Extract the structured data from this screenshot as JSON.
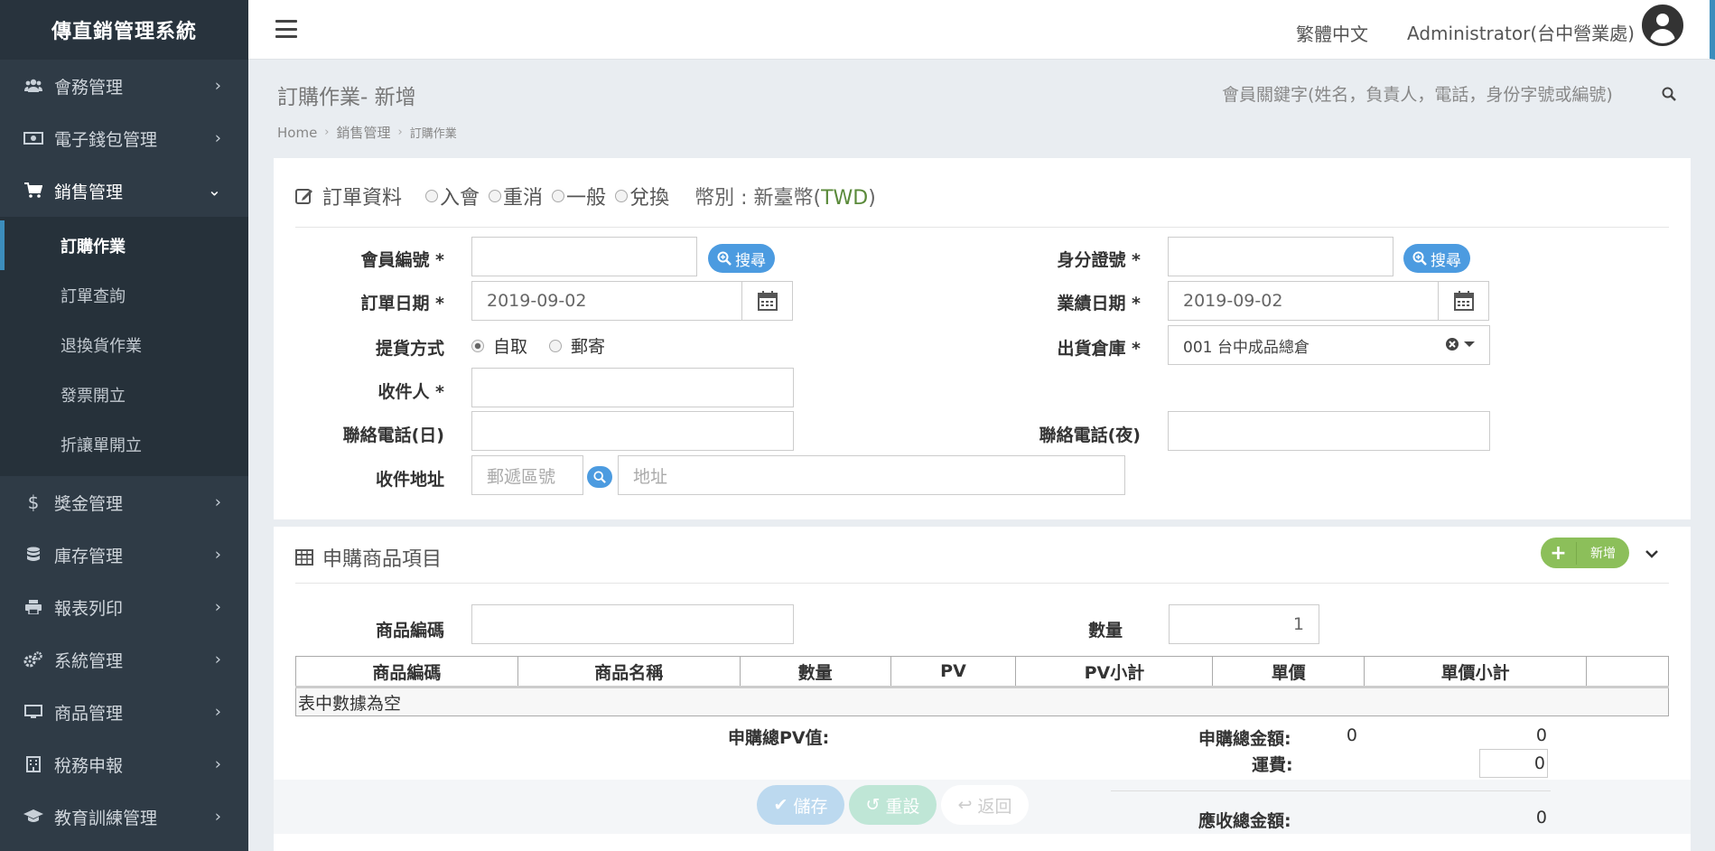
{
  "brand": "傳直銷管理系統",
  "sidebar": {
    "items_before": [
      {
        "label": "會務管理",
        "icon": "users-icon"
      },
      {
        "label": "電子錢包管理",
        "icon": "money-icon"
      }
    ],
    "active_group": {
      "label": "銷售管理",
      "icon": "cart-icon"
    },
    "sub_items": [
      {
        "label": "訂購作業",
        "active": true
      },
      {
        "label": "訂單查詢"
      },
      {
        "label": "退換貨作業"
      },
      {
        "label": "發票開立"
      },
      {
        "label": "折讓單開立"
      }
    ],
    "items_after": [
      {
        "label": "獎金管理",
        "icon": "dollar-icon"
      },
      {
        "label": "庫存管理",
        "icon": "database-icon"
      },
      {
        "label": "報表列印",
        "icon": "print-icon"
      },
      {
        "label": "系統管理",
        "icon": "cogs-icon"
      },
      {
        "label": "商品管理",
        "icon": "monitor-icon"
      },
      {
        "label": "稅務申報",
        "icon": "building-icon"
      },
      {
        "label": "教育訓練管理",
        "icon": "graduation-icon"
      }
    ]
  },
  "topbar": {
    "language": "繁體中文",
    "user": "Administrator(台中營業處)"
  },
  "page": {
    "title": "訂購作業- 新增",
    "search_placeholder": "會員關鍵字(姓名，負責人，電話，身份字號或編號)",
    "breadcrumb": [
      "Home",
      "銷售管理",
      "訂購作業"
    ]
  },
  "order": {
    "section_title": "訂單資料",
    "types": [
      "入會",
      "重消",
      "一般",
      "兌換"
    ],
    "currency_label": "幣別 : 新臺幣(",
    "currency_code": "TWD",
    "currency_close": ")",
    "member_no_label": "會員編號 *",
    "id_no_label": "身分證號 *",
    "search_btn": "搜尋",
    "order_date_label": "訂單日期 *",
    "order_date": "2019-09-02",
    "perf_date_label": "業績日期 *",
    "perf_date": "2019-09-02",
    "delivery_label": "提貨方式",
    "delivery_options": [
      "自取",
      "郵寄"
    ],
    "delivery_selected": "自取",
    "warehouse_label": "出貨倉庫 *",
    "warehouse": "001 台中成品總倉",
    "receiver_label": "收件人 *",
    "phone_day_label": "聯絡電話(日)",
    "phone_night_label": "聯絡電話(夜)",
    "address_label": "收件地址",
    "zip_placeholder": "郵遞區號",
    "address_placeholder": "地址"
  },
  "items": {
    "section_title": "申購商品項目",
    "add_btn": "新增",
    "product_code_label": "商品編碼",
    "qty_label": "數量",
    "qty_value": "1",
    "columns": [
      "商品編碼",
      "商品名稱",
      "數量",
      "PV",
      "PV小計",
      "單價",
      "單價小計",
      ""
    ],
    "empty_text": "表中數據為空",
    "total_pv_label": "申購總PV值:",
    "total_pv": "0",
    "total_amount_label": "申購總金額:",
    "total_amount": "0",
    "shipping_label": "運費:",
    "shipping": "0",
    "receivable_label": "應收總金額:",
    "receivable": "0",
    "save_btn": "儲存",
    "reset_btn": "重設",
    "back_btn": "返回"
  }
}
